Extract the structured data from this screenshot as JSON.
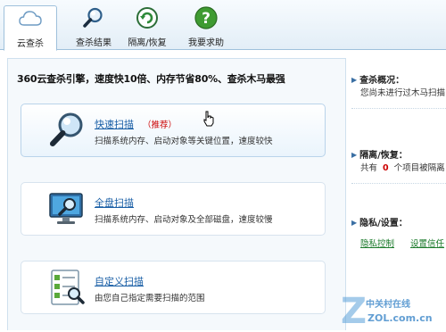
{
  "tabs": [
    {
      "label": "云查杀",
      "icon": "cloud-icon",
      "active": true
    },
    {
      "label": "查杀结果",
      "icon": "magnifier-icon"
    },
    {
      "label": "隔离/恢复",
      "icon": "shield-restore-icon"
    },
    {
      "label": "我要求助",
      "icon": "help-icon"
    }
  ],
  "main": {
    "headline": "360云查杀引擎，速度快10倍、内存节省80%、查杀木马最强",
    "cards": [
      {
        "title": "快速扫描",
        "badge": "（推荐）",
        "desc": "扫描系统内存、启动对象等关键位置，速度较快",
        "icon": "quick-scan-magnifier-icon"
      },
      {
        "title": "全盘扫描",
        "desc": "扫描系统内存、启动对象及全部磁盘，速度较慢",
        "icon": "monitor-scan-icon"
      },
      {
        "title": "自定义扫描",
        "desc": "由您自己指定需要扫描的范围",
        "icon": "checklist-scan-icon"
      }
    ]
  },
  "side": {
    "scan_status": {
      "title": "查杀概况：",
      "text": "您尚未进行过木马扫描"
    },
    "quarantine": {
      "title": "隔离/恢复：",
      "prefix": "共有",
      "count": "0",
      "suffix": "个项目被隔离"
    },
    "privacy": {
      "title": "隐私/设置：",
      "links": [
        "隐私控制",
        "设置信任"
      ]
    }
  },
  "watermark": {
    "brand": "中关村在线",
    "site": "ZOL.com.cn",
    "brand_color": "#3b86c8"
  },
  "colors": {
    "accent": "#1a5fa6",
    "warning": "#cc0000",
    "link_green": "#1a7a2a"
  }
}
